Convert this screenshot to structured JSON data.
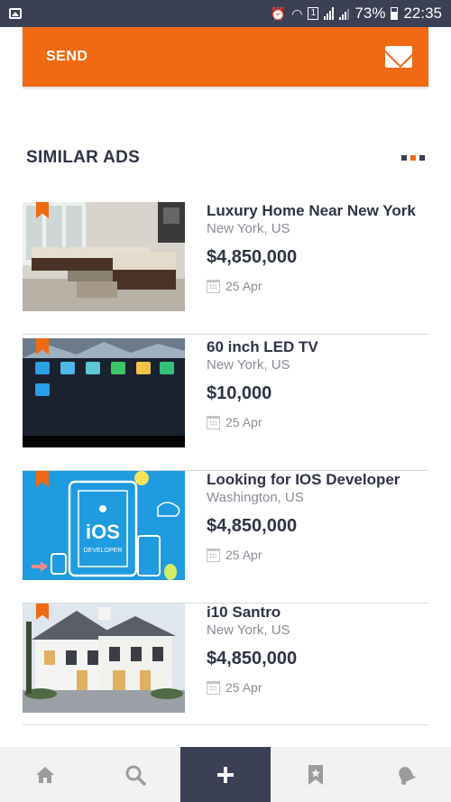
{
  "status": {
    "battery": "73%",
    "time": "22:35",
    "sim_number": "1"
  },
  "send_button": {
    "label": "SEND",
    "icon": "envelope-icon"
  },
  "section": {
    "title": "SIMILAR ADS"
  },
  "ads": [
    {
      "title": "Luxury Home Near New York",
      "location": "New York, US",
      "price": "$4,850,000",
      "date": "25 Apr",
      "image": "sofa-living-room"
    },
    {
      "title": "60 inch LED TV",
      "location": "New York, US",
      "price": "$10,000",
      "date": "25 Apr",
      "image": "led-tv"
    },
    {
      "title": "Looking for IOS Developer",
      "location": "Washington, US",
      "price": "$4,850,000",
      "date": "25 Apr",
      "image": "ios-developer",
      "image_text": "iOS",
      "image_subtext": "DEVELOPER"
    },
    {
      "title": "i10 Santro",
      "location": "New York, US",
      "price": "$4,850,000",
      "date": "25 Apr",
      "image": "white-house"
    }
  ],
  "bottom_nav": [
    {
      "icon": "home-icon"
    },
    {
      "icon": "search-icon"
    },
    {
      "icon": "plus-icon",
      "active": true
    },
    {
      "icon": "bookmark-star-icon"
    },
    {
      "icon": "bell-icon"
    }
  ],
  "colors": {
    "accent": "#ef6a13",
    "dark": "#3b4054",
    "text": "#2f3445",
    "muted": "#8a8d96"
  }
}
